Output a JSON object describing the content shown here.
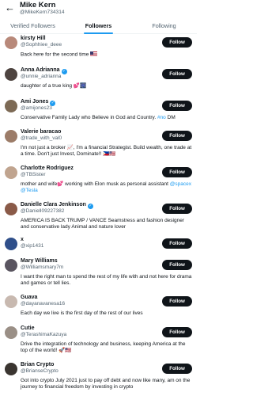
{
  "header": {
    "title": "Mike Kern",
    "handle": "@MikeKern734314"
  },
  "tabs": [
    {
      "label": "Verified Followers"
    },
    {
      "label": "Followers"
    },
    {
      "label": "Following"
    }
  ],
  "follow_label": "Follow",
  "users": [
    {
      "name": "kirsty Hill",
      "handle": "@Sophhiee_deee",
      "bio": "Back here for the second time",
      "avatar_color": "#b8897a"
    },
    {
      "name": "Anna Adrianna",
      "handle": "@unnie_adrianna",
      "bio": "daughter of a true king",
      "avatar_color": "#4e4440"
    },
    {
      "name": "Ami Jones",
      "handle": "@amijones23",
      "bio": "Conservative Family Lady who Believe in God and Country.",
      "bio_link": "#no",
      "bio_end": " DM",
      "avatar_color": "#7d6a55"
    },
    {
      "name": "Valerie baracao",
      "handle": "@trade_with_val0",
      "bio": "I'm not just a broker 📈, I'm a financial Strategist. Build wealth, one trade at a time. Don't just Invest, Dominate!!",
      "avatar_color": "#9c7c68"
    },
    {
      "name": "Charlotte Rodriguez",
      "handle": "@TBSister",
      "bio": "mother and wife💕 working with Elon musk as personal assistant",
      "bio_link": "@spacex @Tesla",
      "avatar_color": "#c0a48f"
    },
    {
      "name": "Danielle Clara Jenkinson",
      "handle": "@Daniell09227382",
      "bio": "AMERICA IS BACK TRUMP / VANCE Seamstress and fashion designer and conservative lady Animal and nature lover",
      "avatar_color": "#8a5a48"
    },
    {
      "name": "x",
      "handle": "@xip1431",
      "bio": "",
      "avatar_color": "#2f4f8a"
    },
    {
      "name": "Mary Williams",
      "handle": "@Williamsmary7m",
      "bio": "I want the right man to spend the rest of my life with and not here for drama and games or tell lies.",
      "avatar_color": "#5a5560"
    },
    {
      "name": "Guava",
      "handle": "@dayanavanesa16",
      "bio": "Each day we live is the first day of the rest of our lives",
      "avatar_color": "#c8b9b0"
    },
    {
      "name": "Cutie",
      "handle": "@TerashimaKazuya",
      "bio": "Drive the integration of technology and business, keeping America at the top of the world!",
      "avatar_color": "#9a8f86"
    },
    {
      "name": "Brian Crypto",
      "handle": "@BrianseCrypto",
      "bio": "Got into crypto July 2021 just to pay off debt and now like many, am on the journey to financial freedom by investing in crypto",
      "avatar_color": "#3a3530"
    }
  ]
}
